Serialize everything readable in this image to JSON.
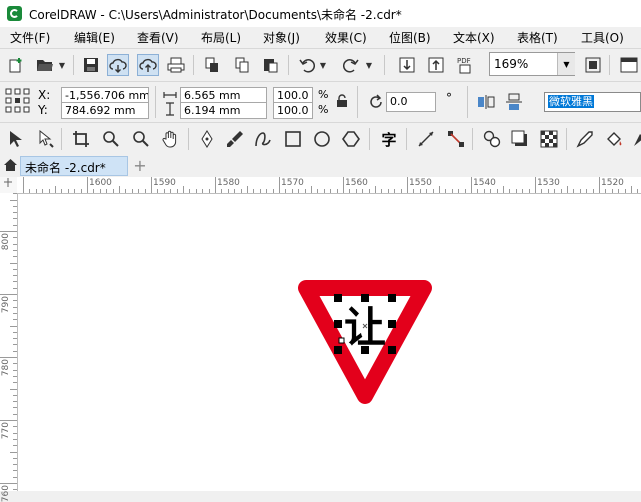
{
  "window": {
    "title": "CorelDRAW - C:\\Users\\Administrator\\Documents\\未命名 -2.cdr*"
  },
  "menu": [
    {
      "label": "文件(F)"
    },
    {
      "label": "编辑(E)"
    },
    {
      "label": "查看(V)"
    },
    {
      "label": "布局(L)"
    },
    {
      "label": "对象(J)"
    },
    {
      "label": "效果(C)"
    },
    {
      "label": "位图(B)"
    },
    {
      "label": "文本(X)"
    },
    {
      "label": "表格(T)"
    },
    {
      "label": "工具(O)"
    }
  ],
  "toolbar": {
    "zoom": "169%"
  },
  "props": {
    "x_label": "X:",
    "y_label": "Y:",
    "x": "-1,556.706 mm",
    "y": "784.692 mm",
    "width": "6.565 mm",
    "height": "6.194 mm",
    "scale_w": "100.0",
    "scale_h": "100.0",
    "percent": "%",
    "rotation": "0.0",
    "degree": "°",
    "font": "微软雅黑"
  },
  "document": {
    "tab": "未命名 -2.cdr*",
    "add": "+"
  },
  "ruler": {
    "h_labels": [
      "1600",
      "1590",
      "1580",
      "1570",
      "1560",
      "1550",
      "1540",
      "1530",
      "1520"
    ],
    "v_labels": [
      "800",
      "790",
      "780",
      "770",
      "760"
    ]
  },
  "sign": {
    "text": "让",
    "border_color": "#e3001b",
    "fill_color": "#ffffff"
  }
}
